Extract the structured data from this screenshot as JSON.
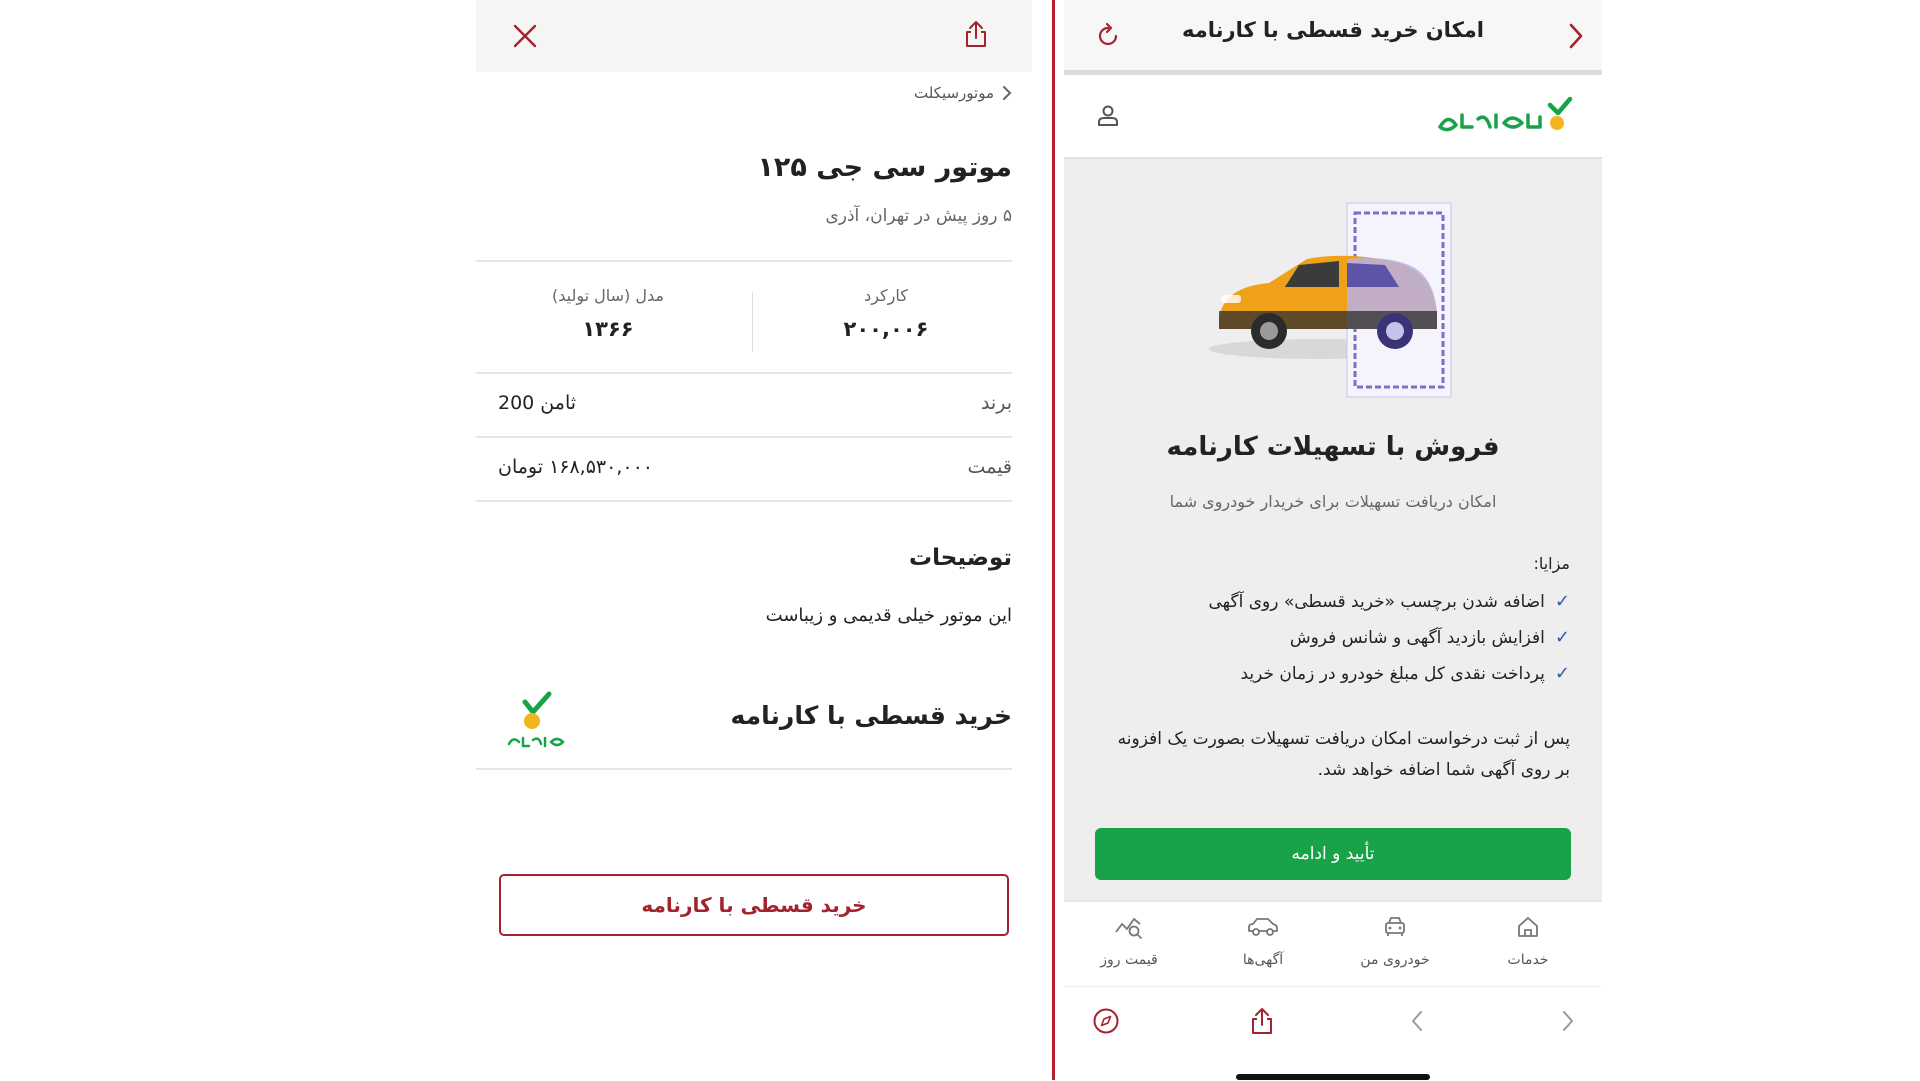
{
  "left": {
    "breadcrumb": "موتورسیکلت",
    "title": "موتور سی جی ۱۲۵",
    "subtitle": "۵ روز پیش در تهران، آذری",
    "stats": [
      {
        "label": "کارکرد",
        "value": "۲۰۰,۰۰۶"
      },
      {
        "label": "مدل (سال تولید)",
        "value": "۱۳۶۶"
      }
    ],
    "details": [
      {
        "key": "برند",
        "value": "ثامن 200"
      },
      {
        "key": "قیمت",
        "value": "۱۶۸,۵۳۰,۰۰۰ تومان"
      }
    ],
    "description_title": "توضیحات",
    "description_text": "این موتور خیلی قدیمی و زیباست",
    "karnameh_section_title": "خرید قسطی با کارنامه",
    "cta_label": "خرید قسطی با کارنامه",
    "icons": {
      "close": "close-icon",
      "share": "share-icon",
      "breadcrumb_arrow": "chevron-right-icon"
    }
  },
  "right": {
    "page_title": "امکان خرید قسطی با کارنامه",
    "brand_name": "کارنامه",
    "promo_title": "فروش با تسهیلات کارنامه",
    "promo_subtitle": "امکان دریافت تسهیلات برای خریدار خودروی شما",
    "benefits_label": "مزایا:",
    "benefits": [
      "اضافه شدن برچسب «خرید قسطی» روی آگهی",
      "افزایش بازدید آگهی و شانس فروش",
      "پرداخت نقدی کل مبلغ خودرو در زمان خرید"
    ],
    "note": "پس از ثبت درخواست امکان دریافت تسهیلات بصورت یک افزونه بر روی آگهی شما اضافه خواهد شد.",
    "cta_label": "تأیید و ادامه",
    "nav": [
      {
        "label": "خدمات",
        "icon": "home-icon"
      },
      {
        "label": "خودروی من",
        "icon": "car-front-icon"
      },
      {
        "label": "آگهی‌ها",
        "icon": "car-side-icon"
      },
      {
        "label": "قیمت روز",
        "icon": "price-chart-icon"
      }
    ]
  },
  "colors": {
    "accent_red": "#a3232e",
    "karnameh_green": "#19a349",
    "karnameh_yellow": "#f2b51e",
    "check_blue": "#2f5aa8"
  }
}
